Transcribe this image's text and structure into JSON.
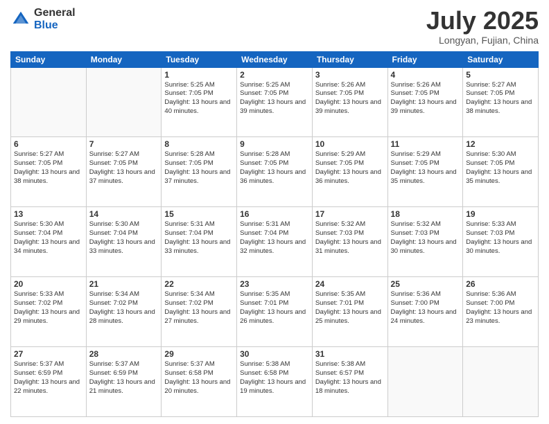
{
  "header": {
    "logo_general": "General",
    "logo_blue": "Blue",
    "month": "July 2025",
    "location": "Longyan, Fujian, China"
  },
  "days_of_week": [
    "Sunday",
    "Monday",
    "Tuesday",
    "Wednesday",
    "Thursday",
    "Friday",
    "Saturday"
  ],
  "weeks": [
    [
      {
        "day": "",
        "empty": true
      },
      {
        "day": "",
        "empty": true
      },
      {
        "day": "1",
        "sunrise": "5:25 AM",
        "sunset": "7:05 PM",
        "daylight": "13 hours and 40 minutes."
      },
      {
        "day": "2",
        "sunrise": "5:25 AM",
        "sunset": "7:05 PM",
        "daylight": "13 hours and 39 minutes."
      },
      {
        "day": "3",
        "sunrise": "5:26 AM",
        "sunset": "7:05 PM",
        "daylight": "13 hours and 39 minutes."
      },
      {
        "day": "4",
        "sunrise": "5:26 AM",
        "sunset": "7:05 PM",
        "daylight": "13 hours and 39 minutes."
      },
      {
        "day": "5",
        "sunrise": "5:27 AM",
        "sunset": "7:05 PM",
        "daylight": "13 hours and 38 minutes."
      }
    ],
    [
      {
        "day": "6",
        "sunrise": "5:27 AM",
        "sunset": "7:05 PM",
        "daylight": "13 hours and 38 minutes."
      },
      {
        "day": "7",
        "sunrise": "5:27 AM",
        "sunset": "7:05 PM",
        "daylight": "13 hours and 37 minutes."
      },
      {
        "day": "8",
        "sunrise": "5:28 AM",
        "sunset": "7:05 PM",
        "daylight": "13 hours and 37 minutes."
      },
      {
        "day": "9",
        "sunrise": "5:28 AM",
        "sunset": "7:05 PM",
        "daylight": "13 hours and 36 minutes."
      },
      {
        "day": "10",
        "sunrise": "5:29 AM",
        "sunset": "7:05 PM",
        "daylight": "13 hours and 36 minutes."
      },
      {
        "day": "11",
        "sunrise": "5:29 AM",
        "sunset": "7:05 PM",
        "daylight": "13 hours and 35 minutes."
      },
      {
        "day": "12",
        "sunrise": "5:30 AM",
        "sunset": "7:05 PM",
        "daylight": "13 hours and 35 minutes."
      }
    ],
    [
      {
        "day": "13",
        "sunrise": "5:30 AM",
        "sunset": "7:04 PM",
        "daylight": "13 hours and 34 minutes."
      },
      {
        "day": "14",
        "sunrise": "5:30 AM",
        "sunset": "7:04 PM",
        "daylight": "13 hours and 33 minutes."
      },
      {
        "day": "15",
        "sunrise": "5:31 AM",
        "sunset": "7:04 PM",
        "daylight": "13 hours and 33 minutes."
      },
      {
        "day": "16",
        "sunrise": "5:31 AM",
        "sunset": "7:04 PM",
        "daylight": "13 hours and 32 minutes."
      },
      {
        "day": "17",
        "sunrise": "5:32 AM",
        "sunset": "7:03 PM",
        "daylight": "13 hours and 31 minutes."
      },
      {
        "day": "18",
        "sunrise": "5:32 AM",
        "sunset": "7:03 PM",
        "daylight": "13 hours and 30 minutes."
      },
      {
        "day": "19",
        "sunrise": "5:33 AM",
        "sunset": "7:03 PM",
        "daylight": "13 hours and 30 minutes."
      }
    ],
    [
      {
        "day": "20",
        "sunrise": "5:33 AM",
        "sunset": "7:02 PM",
        "daylight": "13 hours and 29 minutes."
      },
      {
        "day": "21",
        "sunrise": "5:34 AM",
        "sunset": "7:02 PM",
        "daylight": "13 hours and 28 minutes."
      },
      {
        "day": "22",
        "sunrise": "5:34 AM",
        "sunset": "7:02 PM",
        "daylight": "13 hours and 27 minutes."
      },
      {
        "day": "23",
        "sunrise": "5:35 AM",
        "sunset": "7:01 PM",
        "daylight": "13 hours and 26 minutes."
      },
      {
        "day": "24",
        "sunrise": "5:35 AM",
        "sunset": "7:01 PM",
        "daylight": "13 hours and 25 minutes."
      },
      {
        "day": "25",
        "sunrise": "5:36 AM",
        "sunset": "7:00 PM",
        "daylight": "13 hours and 24 minutes."
      },
      {
        "day": "26",
        "sunrise": "5:36 AM",
        "sunset": "7:00 PM",
        "daylight": "13 hours and 23 minutes."
      }
    ],
    [
      {
        "day": "27",
        "sunrise": "5:37 AM",
        "sunset": "6:59 PM",
        "daylight": "13 hours and 22 minutes."
      },
      {
        "day": "28",
        "sunrise": "5:37 AM",
        "sunset": "6:59 PM",
        "daylight": "13 hours and 21 minutes."
      },
      {
        "day": "29",
        "sunrise": "5:37 AM",
        "sunset": "6:58 PM",
        "daylight": "13 hours and 20 minutes."
      },
      {
        "day": "30",
        "sunrise": "5:38 AM",
        "sunset": "6:58 PM",
        "daylight": "13 hours and 19 minutes."
      },
      {
        "day": "31",
        "sunrise": "5:38 AM",
        "sunset": "6:57 PM",
        "daylight": "13 hours and 18 minutes."
      },
      {
        "day": "",
        "empty": true
      },
      {
        "day": "",
        "empty": true
      }
    ]
  ],
  "labels": {
    "sunrise": "Sunrise:",
    "sunset": "Sunset:",
    "daylight": "Daylight:"
  }
}
